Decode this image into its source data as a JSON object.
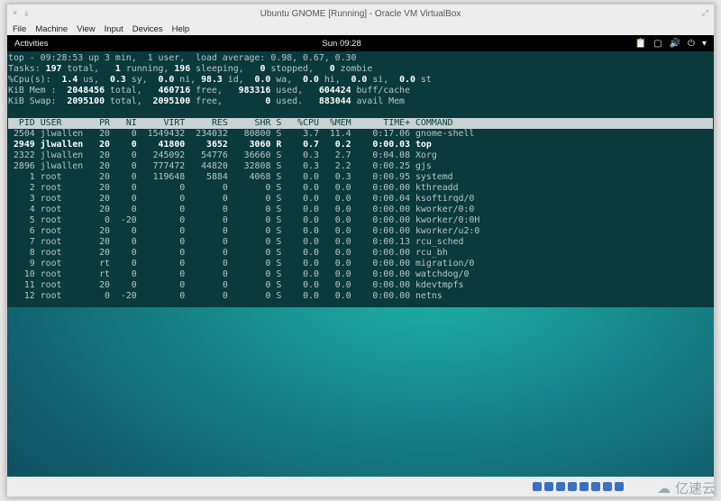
{
  "window": {
    "title": "Ubuntu GNOME [Running] - Oracle VM VirtualBox",
    "menu": [
      "File",
      "Machine",
      "View",
      "Input",
      "Devices",
      "Help"
    ]
  },
  "gnome": {
    "activities": "Activities",
    "clock": "Sun 09:28",
    "tray_icons": [
      "clipboard-icon",
      "window-icon",
      "volume-icon",
      "power-icon",
      "chevron-down-icon"
    ]
  },
  "top": {
    "summary": [
      [
        [
          "top - 09:28:53 up 3 min,  1 user,  load average: 0.98, 0.67, 0.30",
          0
        ]
      ],
      [
        [
          "Tasks: ",
          0
        ],
        [
          "197",
          1
        ],
        [
          " total,   ",
          0
        ],
        [
          "1",
          1
        ],
        [
          " running, ",
          0
        ],
        [
          "196",
          1
        ],
        [
          " sleeping,   ",
          0
        ],
        [
          "0",
          1
        ],
        [
          " stopped,   ",
          0
        ],
        [
          "0",
          1
        ],
        [
          " zombie",
          0
        ]
      ],
      [
        [
          "%Cpu(s):  ",
          0
        ],
        [
          "1.4",
          1
        ],
        [
          " us,  ",
          0
        ],
        [
          "0.3",
          1
        ],
        [
          " sy,  ",
          0
        ],
        [
          "0.0",
          1
        ],
        [
          " ni, ",
          0
        ],
        [
          "98.3",
          1
        ],
        [
          " id,  ",
          0
        ],
        [
          "0.0",
          1
        ],
        [
          " wa,  ",
          0
        ],
        [
          "0.0",
          1
        ],
        [
          " hi,  ",
          0
        ],
        [
          "0.0",
          1
        ],
        [
          " si,  ",
          0
        ],
        [
          "0.0",
          1
        ],
        [
          " st",
          0
        ]
      ],
      [
        [
          "KiB Mem :  ",
          0
        ],
        [
          "2048456",
          1
        ],
        [
          " total,   ",
          0
        ],
        [
          "460716",
          1
        ],
        [
          " free,   ",
          0
        ],
        [
          "983316",
          1
        ],
        [
          " used,   ",
          0
        ],
        [
          "604424",
          1
        ],
        [
          " buff/cache",
          0
        ]
      ],
      [
        [
          "KiB Swap:  ",
          0
        ],
        [
          "2095100",
          1
        ],
        [
          " total,  ",
          0
        ],
        [
          "2095100",
          1
        ],
        [
          " free,        ",
          0
        ],
        [
          "0",
          1
        ],
        [
          " used.   ",
          0
        ],
        [
          "883044",
          1
        ],
        [
          " avail Mem",
          0
        ]
      ]
    ],
    "columns": [
      "PID",
      "USER",
      "PR",
      "NI",
      "VIRT",
      "RES",
      "SHR",
      "S",
      "%CPU",
      "%MEM",
      "TIME+",
      "COMMAND"
    ],
    "processes": [
      {
        "v": [
          "2504",
          "jlwallen",
          "20",
          "0",
          "1549432",
          "234032",
          "80800",
          "S",
          "3.7",
          "11.4",
          "0:17.06",
          "gnome-shell"
        ],
        "bold": false
      },
      {
        "v": [
          "2949",
          "jlwallen",
          "20",
          "0",
          "41800",
          "3652",
          "3060",
          "R",
          "0.7",
          "0.2",
          "0:00.03",
          "top"
        ],
        "bold": true
      },
      {
        "v": [
          "2322",
          "jlwallen",
          "20",
          "0",
          "245092",
          "54776",
          "36660",
          "S",
          "0.3",
          "2.7",
          "0:04.08",
          "Xorg"
        ],
        "bold": false
      },
      {
        "v": [
          "2896",
          "jlwallen",
          "20",
          "0",
          "777472",
          "44820",
          "32808",
          "S",
          "0.3",
          "2.2",
          "0:00.25",
          "gjs"
        ],
        "bold": false
      },
      {
        "v": [
          "1",
          "root",
          "20",
          "0",
          "119648",
          "5884",
          "4068",
          "S",
          "0.0",
          "0.3",
          "0:00.95",
          "systemd"
        ],
        "bold": false
      },
      {
        "v": [
          "2",
          "root",
          "20",
          "0",
          "0",
          "0",
          "0",
          "S",
          "0.0",
          "0.0",
          "0:00.00",
          "kthreadd"
        ],
        "bold": false
      },
      {
        "v": [
          "3",
          "root",
          "20",
          "0",
          "0",
          "0",
          "0",
          "S",
          "0.0",
          "0.0",
          "0:00.04",
          "ksoftirqd/0"
        ],
        "bold": false
      },
      {
        "v": [
          "4",
          "root",
          "20",
          "0",
          "0",
          "0",
          "0",
          "S",
          "0.0",
          "0.0",
          "0:00.00",
          "kworker/0:0"
        ],
        "bold": false
      },
      {
        "v": [
          "5",
          "root",
          "0",
          "-20",
          "0",
          "0",
          "0",
          "S",
          "0.0",
          "0.0",
          "0:00.00",
          "kworker/0:0H"
        ],
        "bold": false
      },
      {
        "v": [
          "6",
          "root",
          "20",
          "0",
          "0",
          "0",
          "0",
          "S",
          "0.0",
          "0.0",
          "0:00.00",
          "kworker/u2:0"
        ],
        "bold": false
      },
      {
        "v": [
          "7",
          "root",
          "20",
          "0",
          "0",
          "0",
          "0",
          "S",
          "0.0",
          "0.0",
          "0:00.13",
          "rcu_sched"
        ],
        "bold": false
      },
      {
        "v": [
          "8",
          "root",
          "20",
          "0",
          "0",
          "0",
          "0",
          "S",
          "0.0",
          "0.0",
          "0:00.00",
          "rcu_bh"
        ],
        "bold": false
      },
      {
        "v": [
          "9",
          "root",
          "rt",
          "0",
          "0",
          "0",
          "0",
          "S",
          "0.0",
          "0.0",
          "0:00.00",
          "migration/0"
        ],
        "bold": false
      },
      {
        "v": [
          "10",
          "root",
          "rt",
          "0",
          "0",
          "0",
          "0",
          "S",
          "0.0",
          "0.0",
          "0:00.00",
          "watchdog/0"
        ],
        "bold": false
      },
      {
        "v": [
          "11",
          "root",
          "20",
          "0",
          "0",
          "0",
          "0",
          "S",
          "0.0",
          "0.0",
          "0:00.00",
          "kdevtmpfs"
        ],
        "bold": false
      },
      {
        "v": [
          "12",
          "root",
          "0",
          "-20",
          "0",
          "0",
          "0",
          "S",
          "0.0",
          "0.0",
          "0:00.00",
          "netns"
        ],
        "bold": false
      }
    ]
  },
  "statusbar": {
    "icons": [
      "hdd-icon",
      "optical-icon",
      "network-icon",
      "usb-icon",
      "shared-folder-icon",
      "display-icon",
      "capture-icon",
      "host-key-icon"
    ]
  },
  "watermark": "亿速云"
}
